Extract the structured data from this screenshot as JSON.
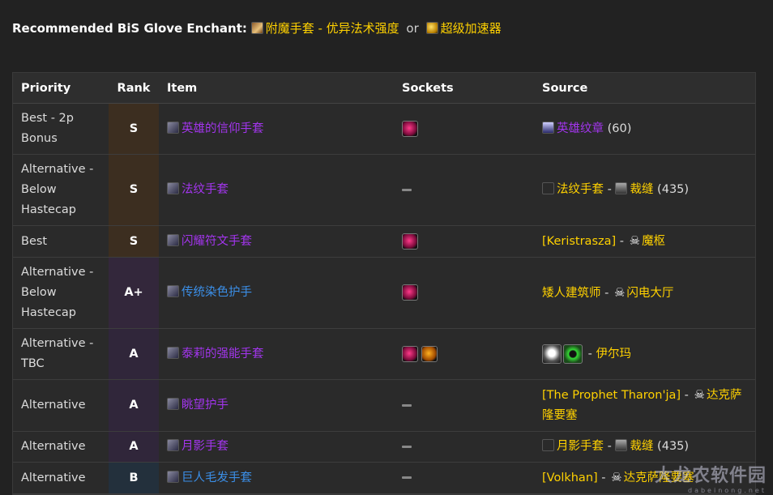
{
  "enchant": {
    "label": "Recommended BiS Glove Enchant",
    "colon": ":",
    "option1": "附魔手套 - 优异法术强度",
    "or": "or",
    "option2": "超级加速器",
    "option1_icon": "scroll-icon",
    "option2_icon": "gear-icon"
  },
  "table": {
    "headers": {
      "priority": "Priority",
      "rank": "Rank",
      "item": "Item",
      "sockets": "Sockets",
      "source": "Source"
    },
    "rows": [
      {
        "priority": "Best - 2p Bonus",
        "rank": "S",
        "item": "英雄的信仰手套",
        "item_color": "#a335ee",
        "sockets": [
          "meta"
        ],
        "source": {
          "icon": "emblem-icon",
          "text": "英雄纹章",
          "suffix": " (60)"
        }
      },
      {
        "priority": "Alternative - Below Hastecap",
        "rank": "S",
        "item": "法纹手套",
        "item_color": "#a335ee",
        "sockets": [],
        "source": {
          "text": "法纹手套",
          "sep": " - ",
          "prof": "裁缝",
          "suffix": " (435)"
        }
      },
      {
        "priority": "Best",
        "rank": "S",
        "item": "闪耀符文手套",
        "item_color": "#a335ee",
        "sockets": [
          "meta"
        ],
        "source": {
          "npc": "[Keristrasza]",
          "sep": " - ",
          "zone": "魔枢"
        }
      },
      {
        "priority": "Alternative - Below Hastecap",
        "rank": "A+",
        "item": "传统染色护手",
        "item_color": "#3b8fe8",
        "sockets": [
          "meta"
        ],
        "source": {
          "npc": "矮人建筑师",
          "sep": " - ",
          "zone": "闪电大厅"
        }
      },
      {
        "priority": "Alternative - TBC",
        "rank": "A",
        "item": "泰莉的强能手套",
        "item_color": "#a335ee",
        "sockets": [
          "meta",
          "orange"
        ],
        "source": {
          "sep": " - ",
          "zone": "伊尔玛"
        }
      },
      {
        "priority": "Alternative",
        "rank": "A",
        "item": "眺望护手",
        "item_color": "#a335ee",
        "sockets": [],
        "source": {
          "npc": "[The Prophet Tharon'ja]",
          "sep": " - ",
          "zone": "达克萨隆要塞"
        }
      },
      {
        "priority": "Alternative",
        "rank": "A",
        "item": "月影手套",
        "item_color": "#a335ee",
        "sockets": [],
        "source": {
          "text": "月影手套",
          "sep": " - ",
          "prof": "裁缝",
          "suffix": " (435)"
        }
      },
      {
        "priority": "Alternative",
        "rank": "B",
        "item": "巨人毛发手套",
        "item_color": "#3b8fe8",
        "sockets": [],
        "source": {
          "npc": "[Volkhan]",
          "sep": " - ",
          "zone": "达克萨隆要塞"
        }
      }
    ]
  },
  "watermark": {
    "main": "大龙农软件园",
    "sub": "dabeinong.net"
  }
}
